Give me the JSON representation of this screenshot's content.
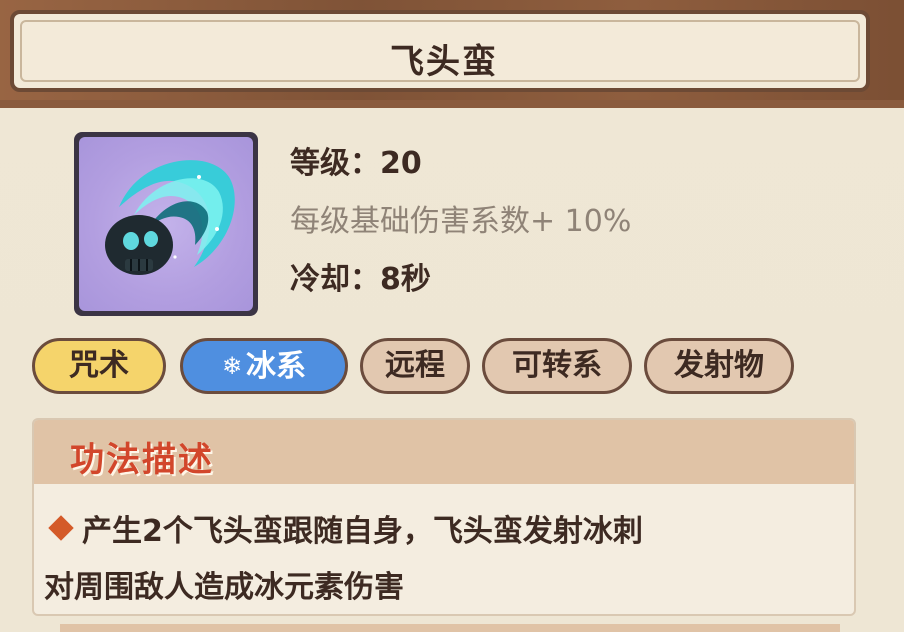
{
  "skill": {
    "name": "飞头蛮",
    "icon": "flying-skull-icon",
    "level_label": "等级：20",
    "growth_label": "每级基础伤害系数+ 10%",
    "cooldown_label": "冷却：8秒"
  },
  "tags": [
    {
      "label": "咒术",
      "color": "#f5d46b"
    },
    {
      "label": "冰系",
      "icon": "snowflake-icon",
      "color": "#4f8fe0"
    },
    {
      "label": "远程",
      "color": "#e2c8b0"
    },
    {
      "label": "可转系",
      "color": "#e2c8b0"
    },
    {
      "label": "发射物",
      "color": "#e2c8b0"
    }
  ],
  "description": {
    "title": "功法描述",
    "line1": "产生2个飞头蛮跟随自身，飞头蛮发射冰刺",
    "line2": "对周围敌人造成冰元素伤害"
  },
  "colors": {
    "title_bar": "#8a5b3d",
    "panel_bg": "#efe7d5",
    "desc_title": "#d2462b",
    "text": "#3d2a22"
  }
}
